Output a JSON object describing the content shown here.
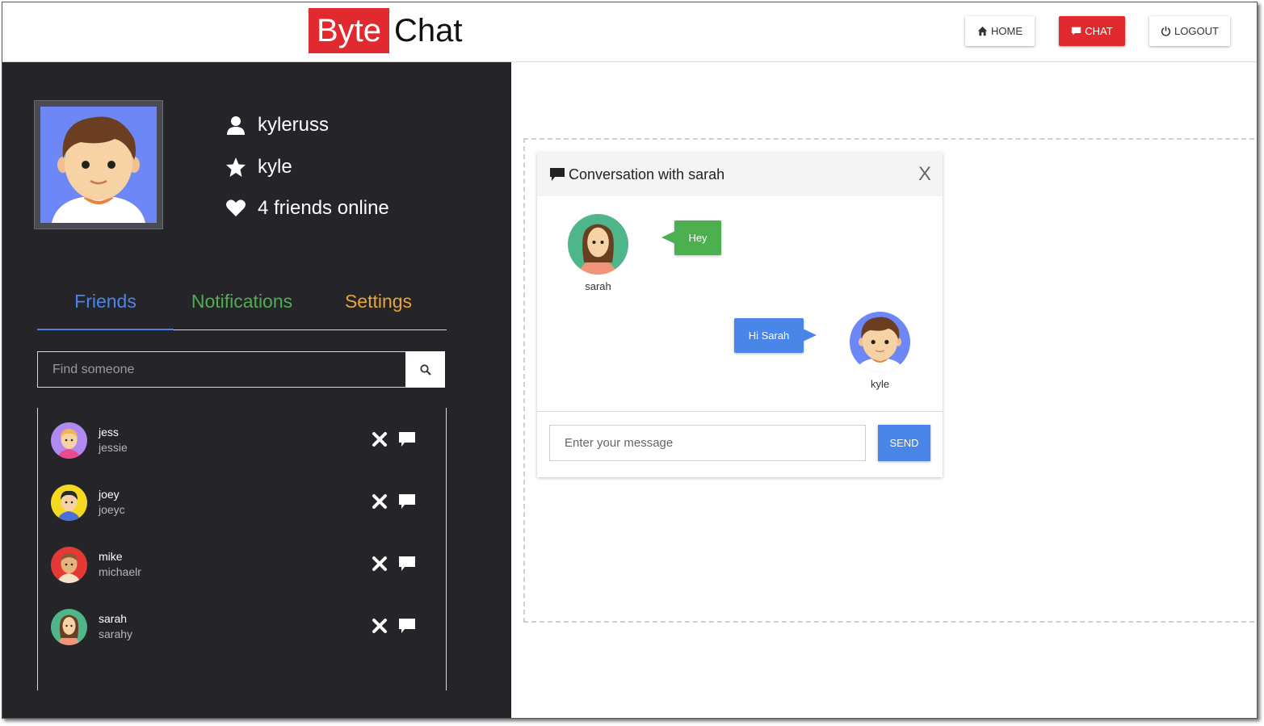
{
  "header": {
    "logo_part1": "Byte",
    "logo_part2": "Chat",
    "nav": {
      "home": "HOME",
      "chat": "CHAT",
      "logout": "LOGOUT"
    }
  },
  "profile": {
    "username": "kyleruss",
    "display_name": "kyle",
    "friends_online": "4 friends online"
  },
  "tabs": {
    "friends": "Friends",
    "notifications": "Notifications",
    "settings": "Settings"
  },
  "search": {
    "placeholder": "Find someone"
  },
  "friends": [
    {
      "name": "jess",
      "username": "jessie"
    },
    {
      "name": "joey",
      "username": "joeyc"
    },
    {
      "name": "mike",
      "username": "michaelr"
    },
    {
      "name": "sarah",
      "username": "sarahy"
    }
  ],
  "conversation": {
    "title": "Conversation with sarah",
    "close": "X",
    "messages": [
      {
        "from": "sarah",
        "text": "Hey"
      },
      {
        "from": "kyle",
        "text": "Hi Sarah"
      }
    ],
    "input_placeholder": "Enter your message",
    "send": "SEND"
  },
  "colors": {
    "brand_red": "#e12a2f",
    "sidebar_bg": "#242429",
    "friends_tab": "#4a86e8",
    "notifications_tab": "#4caf50",
    "settings_tab": "#e8a33a",
    "bubble_received": "#4caf50",
    "bubble_sent": "#4a86e8"
  },
  "icons": {
    "home": "home-icon",
    "chat": "chat-icon",
    "logout": "power-icon",
    "user": "user-icon",
    "star": "star-icon",
    "heart": "heart-icon",
    "search": "search-icon",
    "remove": "close-icon",
    "message": "message-icon"
  }
}
